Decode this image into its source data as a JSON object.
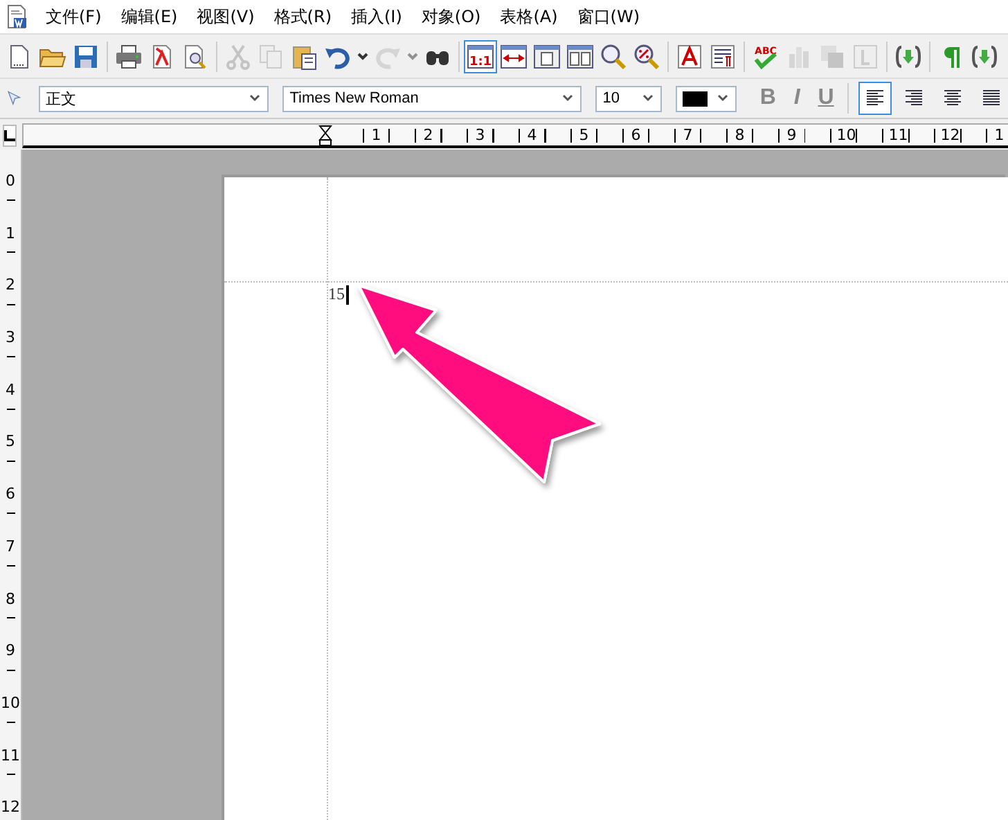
{
  "menu": [
    "文件(F)",
    "编辑(E)",
    "视图(V)",
    "格式(R)",
    "插入(I)",
    "对象(O)",
    "表格(A)",
    "窗口(W)"
  ],
  "toolbar": [
    {
      "kind": "new",
      "disabled": false,
      "selected": false
    },
    {
      "kind": "open",
      "disabled": false,
      "selected": false
    },
    {
      "kind": "save",
      "disabled": false,
      "selected": false
    },
    {
      "kind": "sep"
    },
    {
      "kind": "print",
      "disabled": false,
      "selected": false
    },
    {
      "kind": "pdf",
      "disabled": false,
      "selected": false
    },
    {
      "kind": "preview",
      "disabled": false,
      "selected": false
    },
    {
      "kind": "sep"
    },
    {
      "kind": "cut",
      "disabled": true,
      "selected": false
    },
    {
      "kind": "copy",
      "disabled": true,
      "selected": false
    },
    {
      "kind": "paste",
      "disabled": false,
      "selected": false
    },
    {
      "kind": "undo",
      "disabled": false,
      "selected": false
    },
    {
      "kind": "caret",
      "disabled": false,
      "selected": false
    },
    {
      "kind": "redo",
      "disabled": true,
      "selected": false
    },
    {
      "kind": "caret",
      "disabled": true,
      "selected": false
    },
    {
      "kind": "find",
      "disabled": false,
      "selected": false
    },
    {
      "kind": "sep"
    },
    {
      "kind": "actual-size",
      "text": "1:1",
      "disabled": false,
      "selected": true
    },
    {
      "kind": "page-width",
      "disabled": false,
      "selected": false
    },
    {
      "kind": "whole-page",
      "disabled": false,
      "selected": false
    },
    {
      "kind": "two-pages",
      "disabled": false,
      "selected": false
    },
    {
      "kind": "zoom",
      "disabled": false,
      "selected": false
    },
    {
      "kind": "zoom-percent",
      "disabled": false,
      "selected": false
    },
    {
      "kind": "sep"
    },
    {
      "kind": "font",
      "disabled": false,
      "selected": false
    },
    {
      "kind": "paragraph",
      "disabled": false,
      "selected": false
    },
    {
      "kind": "sep"
    },
    {
      "kind": "spell",
      "text": "ABC",
      "disabled": false,
      "selected": false
    },
    {
      "kind": "chart",
      "disabled": true,
      "selected": false
    },
    {
      "kind": "shape",
      "disabled": true,
      "selected": false
    },
    {
      "kind": "frame",
      "disabled": true,
      "selected": false
    },
    {
      "kind": "sep"
    },
    {
      "kind": "field",
      "disabled": false,
      "selected": false
    },
    {
      "kind": "sep"
    },
    {
      "kind": "pilcrow",
      "disabled": false,
      "selected": false
    },
    {
      "kind": "field",
      "disabled": false,
      "selected": false
    }
  ],
  "format": {
    "style": "正文",
    "font": "Times New Roman",
    "size": "10",
    "color": "#000000",
    "styles": [
      {
        "label": "B",
        "kind": "bold",
        "selected": false
      },
      {
        "label": "I",
        "kind": "italic",
        "selected": false
      },
      {
        "label": "U",
        "kind": "underline",
        "selected": false
      }
    ],
    "align": [
      {
        "kind": "left",
        "selected": true
      },
      {
        "kind": "right",
        "selected": false
      },
      {
        "kind": "center",
        "selected": false
      },
      {
        "kind": "justify",
        "selected": false
      }
    ]
  },
  "ruler": {
    "h": [
      "1",
      "2",
      "3",
      "4",
      "5",
      "6",
      "7",
      "8",
      "9",
      "10",
      "11",
      "12",
      "1"
    ],
    "v": [
      "0",
      "1",
      "2",
      "3",
      "4",
      "5",
      "6",
      "7",
      "8",
      "9",
      "10",
      "11",
      "12"
    ]
  },
  "document": {
    "text": "15"
  }
}
